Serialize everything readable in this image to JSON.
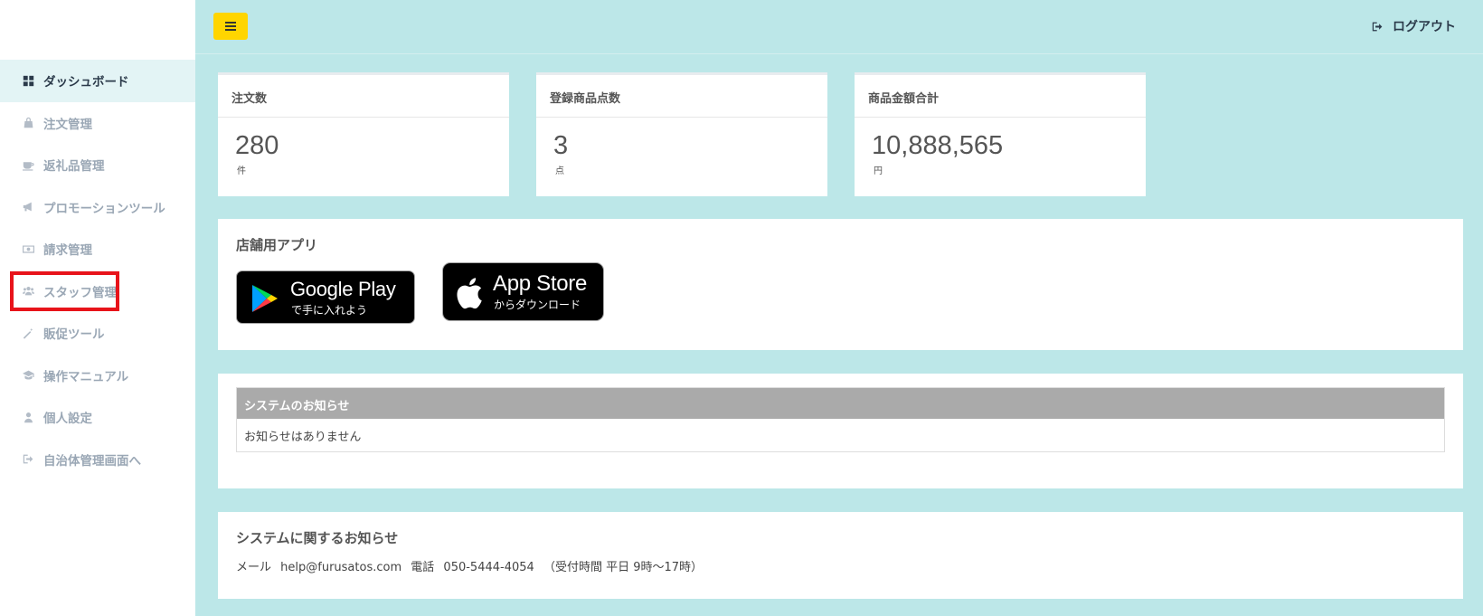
{
  "sidebar": {
    "items": [
      {
        "label": "ダッシュボード",
        "icon": "dashboard-icon",
        "active": true
      },
      {
        "label": "注文管理",
        "icon": "shopping-bag-icon"
      },
      {
        "label": "返礼品管理",
        "icon": "coffee-icon"
      },
      {
        "label": "プロモーションツール",
        "icon": "megaphone-icon"
      },
      {
        "label": "請求管理",
        "icon": "money-icon"
      },
      {
        "label": "スタッフ管理",
        "icon": "users-icon"
      },
      {
        "label": "販促ツール",
        "icon": "magic-wand-icon"
      },
      {
        "label": "操作マニュアル",
        "icon": "graduation-cap-icon"
      },
      {
        "label": "個人設定",
        "icon": "user-icon"
      },
      {
        "label": "自治体管理画面へ",
        "icon": "sign-out-icon"
      }
    ]
  },
  "header": {
    "logout_label": "ログアウト"
  },
  "stats": [
    {
      "title": "注文数",
      "value": "280",
      "unit": "件"
    },
    {
      "title": "登録商品点数",
      "value": "3",
      "unit": "点"
    },
    {
      "title": "商品金額合計",
      "value": "10,888,565",
      "unit": "円"
    }
  ],
  "apps": {
    "title": "店舗用アプリ",
    "google_play": {
      "main": "Google Play",
      "sub": "で手に入れよう"
    },
    "app_store": {
      "main": "App Store",
      "sub": "からダウンロード"
    }
  },
  "notices": {
    "header": "システムのお知らせ",
    "empty_text": "お知らせはありません"
  },
  "system_info": {
    "title": "システムに関するお知らせ",
    "mail_label": "メール",
    "mail": "help@furusatos.com",
    "phone_label": "電話",
    "phone": "050-5444-4054",
    "hours": "（受付時間 平日 9時〜17時）"
  },
  "colors": {
    "background": "#bce7e8",
    "menu_button": "#ffd500",
    "highlight": "#e8131a",
    "notice_header": "#aaaaaa"
  }
}
